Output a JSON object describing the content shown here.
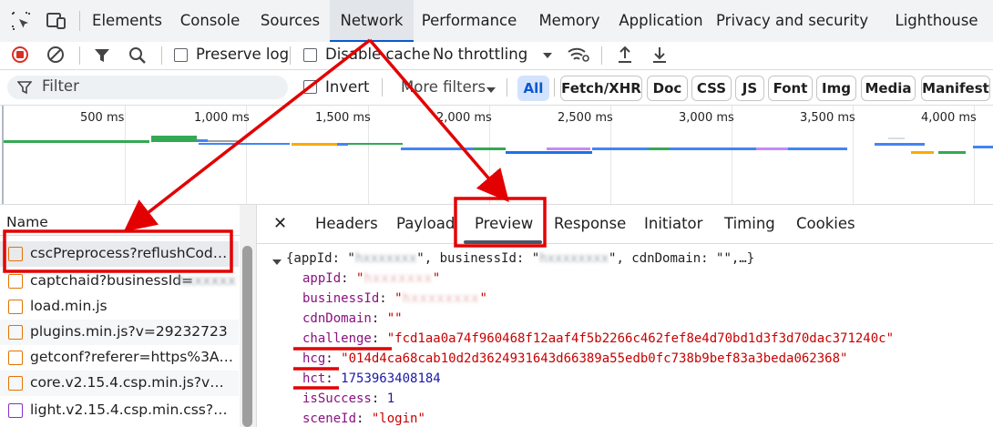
{
  "tabs": [
    "Elements",
    "Console",
    "Sources",
    "Network",
    "Performance",
    "Memory",
    "Application",
    "Privacy and security",
    "Lighthouse"
  ],
  "toolbar": {
    "preserve_log": "Preserve log",
    "disable_cache": "Disable cache",
    "throttling": "No throttling"
  },
  "filterbar": {
    "filter_placeholder": "Filter",
    "invert": "Invert",
    "more_filters": "More filters",
    "types": [
      "All",
      "Fetch/XHR",
      "Doc",
      "CSS",
      "JS",
      "Font",
      "Img",
      "Media",
      "Manifest"
    ]
  },
  "overview": {
    "ticks": [
      "500 ms",
      "1,000 ms",
      "1,500 ms",
      "2,000 ms",
      "2,500 ms",
      "3,000 ms",
      "3,500 ms",
      "4,000 ms"
    ]
  },
  "request_list": {
    "header": "Name",
    "rows": [
      {
        "name": "cscPreprocess?reflushCode=...",
        "type": "json"
      },
      {
        "name": "captchaid?businessId=",
        "type": "json",
        "blur": "hxxxxxx"
      },
      {
        "name": "load.min.js",
        "type": "js"
      },
      {
        "name": "plugins.min.js?v=29232723",
        "type": "js"
      },
      {
        "name": "getconf?referer=https%3A%...",
        "type": "json"
      },
      {
        "name": "core.v2.15.4.csp.min.js?v=29...",
        "type": "js"
      },
      {
        "name": "light.v2.15.4.csp.min.css?v=2...",
        "type": "css"
      }
    ]
  },
  "detail": {
    "close": "✕",
    "tabs": [
      "Headers",
      "Payload",
      "Preview",
      "Response",
      "Initiator",
      "Timing",
      "Cookies"
    ],
    "preview": {
      "summary_prefix": "{appId: \"",
      "summary_mid1": "\", businessId: \"",
      "summary_mid2": "\", cdnDomain: \"\",…}",
      "lines": [
        {
          "key": "appId",
          "sep": ": ",
          "open": "\"",
          "value": "hxxxxxxx",
          "close": "\"",
          "kind": "blur"
        },
        {
          "key": "businessId",
          "sep": ": ",
          "open": "\"",
          "value": "hxxxxxxxx",
          "close": "\"",
          "kind": "blur"
        },
        {
          "key": "cdnDomain",
          "sep": ": ",
          "open": "",
          "value": "\"\"",
          "close": "",
          "kind": "str"
        },
        {
          "key": "challenge",
          "sep": ": ",
          "open": "",
          "value": "\"fcd1aa0a74f960468f12aaf4f5b2266c462fef8e4d70bd1d3f3d70dac371240c\"",
          "close": "",
          "kind": "str"
        },
        {
          "key": "hcg",
          "sep": ": ",
          "open": "",
          "value": "\"014d4ca68cab10d2d3624931643d66389a55edb0fc738b9bef83a3beda062368\"",
          "close": "",
          "kind": "str"
        },
        {
          "key": "hct",
          "sep": ": ",
          "open": "",
          "value": "1753963408184",
          "close": "",
          "kind": "num"
        },
        {
          "key": "isSuccess",
          "sep": ": ",
          "open": "",
          "value": "1",
          "close": "",
          "kind": "num"
        },
        {
          "key": "sceneId",
          "sep": ": ",
          "open": "",
          "value": "\"login\"",
          "close": "",
          "kind": "str"
        }
      ]
    }
  },
  "colors": {
    "annotation_red": "#e30000",
    "accent_blue": "#0b57d0",
    "record_red": "#d93025"
  }
}
